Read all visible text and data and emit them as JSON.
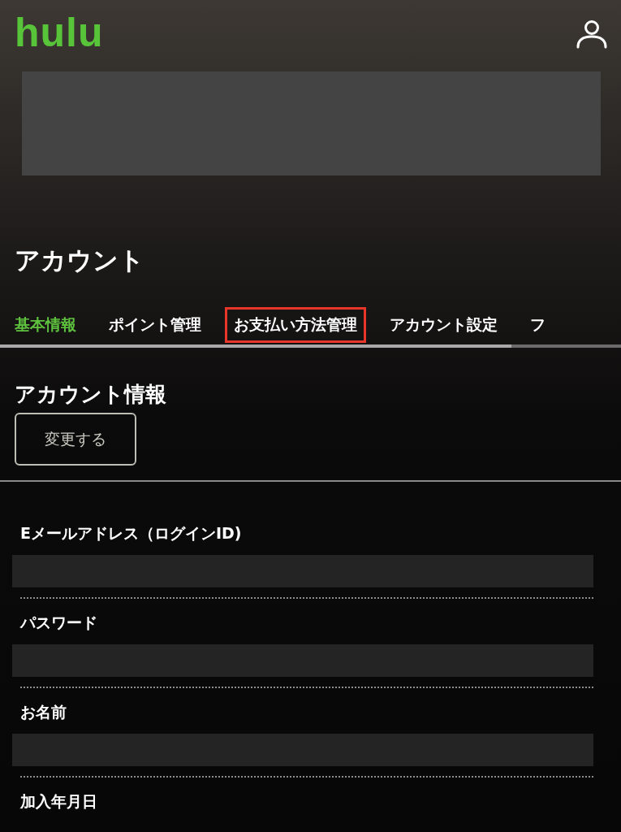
{
  "header": {
    "logo": "hulu"
  },
  "page_title": "アカウント",
  "tabs": [
    {
      "label": "基本情報",
      "selected": true,
      "highlighted": false
    },
    {
      "label": "ポイント管理",
      "selected": false,
      "highlighted": false
    },
    {
      "label": "お支払い方法管理",
      "selected": false,
      "highlighted": true
    },
    {
      "label": "アカウント設定",
      "selected": false,
      "highlighted": false
    },
    {
      "label": "フ",
      "selected": false,
      "highlighted": false
    }
  ],
  "section": {
    "title": "アカウント情報",
    "button": "変更する"
  },
  "fields": [
    {
      "label": "Eメールアドレス（ログインID)",
      "redacted": true
    },
    {
      "label": "パスワード",
      "redacted": true
    },
    {
      "label": "お名前",
      "redacted": true
    },
    {
      "label": "加入年月日",
      "redacted": false
    }
  ]
}
